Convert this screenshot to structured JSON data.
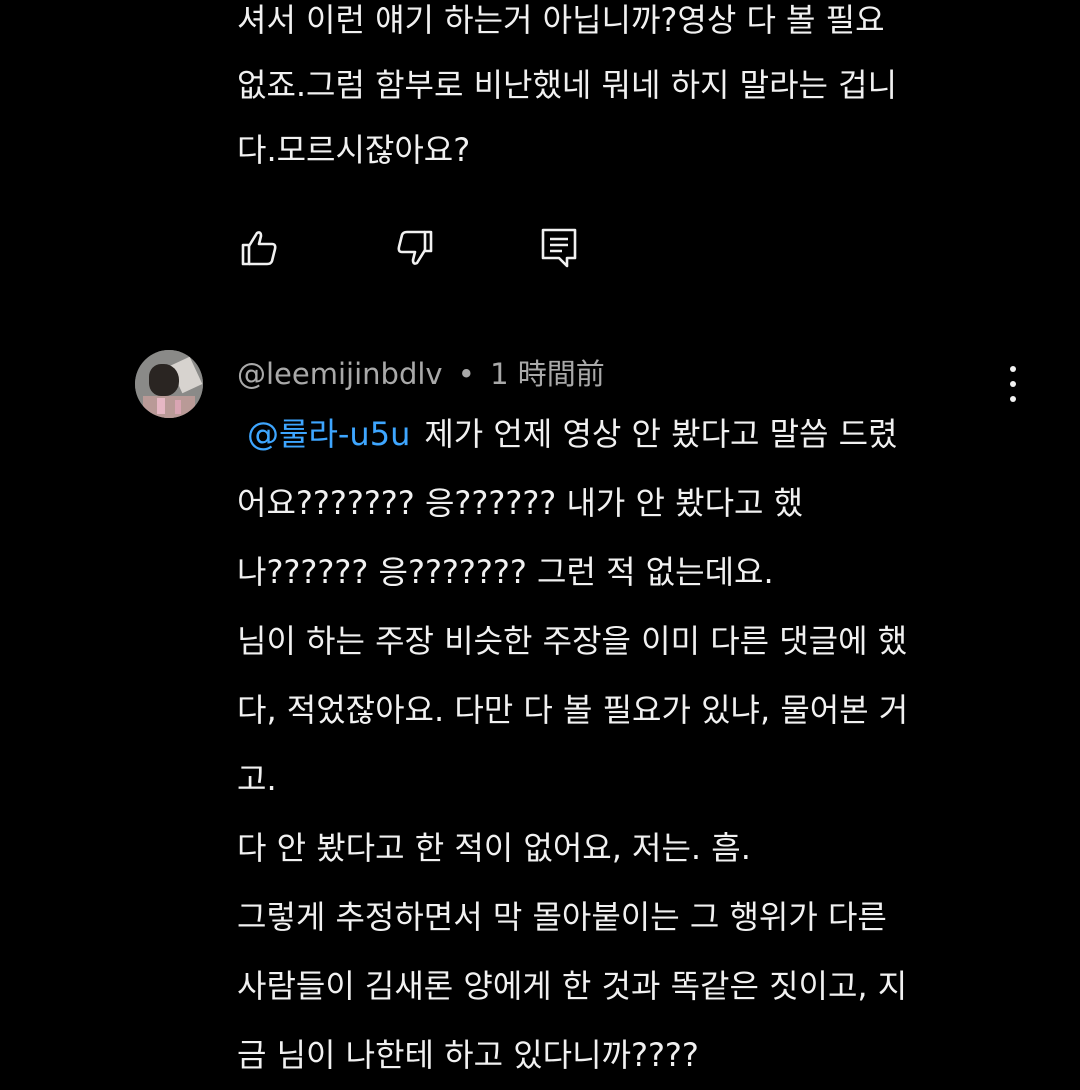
{
  "previous_comment": {
    "lines": [
      "셔서 이런 얘기 하는거 아닙니까?영상 다 볼 필요",
      "없죠.그럼 함부로 비난했네 뭐네 하지 말라는 겁니",
      "다.모르시잖아요?"
    ],
    "actions": {
      "like_icon": "thumbs-up-icon",
      "dislike_icon": "thumbs-down-icon",
      "reply_icon": "reply-comment-icon"
    }
  },
  "comment": {
    "author": "@leemijinbdlv",
    "separator": "•",
    "time": "1 時間前",
    "mention": "@룰라-u5u",
    "first_line_rest": "제가 언제 영상 안 봤다고 말씀 드렸",
    "lines": [
      "어요??????? 응?????? 내가 안 봤다고 했",
      "나?????? 응??????? 그런 적 없는데요.",
      "님이 하는 주장 비슷한 주장을 이미 다른 댓글에 했",
      "다, 적었잖아요. 다만 다 볼 필요가 있냐, 물어본 거",
      "고.",
      "다 안 봤다고 한 적이 없어요, 저는. 흠.",
      "그렇게 추정하면서 막 몰아붙이는 그 행위가 다른",
      "사람들이 김새론 양에게 한 것과 똑같은 짓이고, 지",
      "금 님이 나한테 하고 있다니까????"
    ],
    "menu_icon": "more-vertical-icon",
    "avatar_icon": "avatar-photo"
  },
  "colors": {
    "background": "#000000",
    "text": "#f1f1f1",
    "meta": "#a9a9a9",
    "mention": "#3ea6ff"
  }
}
